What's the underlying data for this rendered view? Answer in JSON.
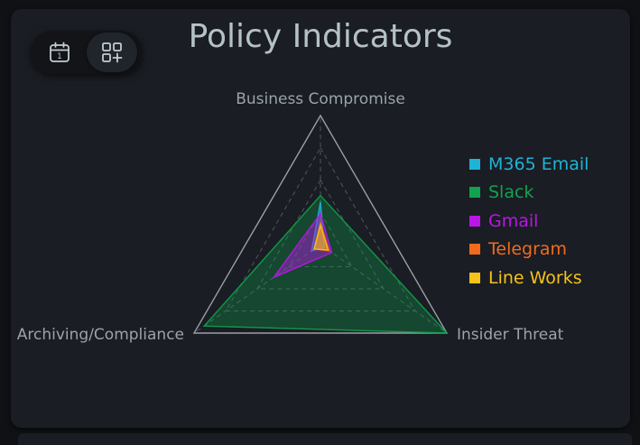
{
  "title": "Policy Indicators",
  "toolbar": {
    "calendar_icon": "calendar-icon",
    "calendar_day": "1",
    "grid_icon": "grid-add-icon"
  },
  "chart_data": {
    "type": "radar",
    "axes": [
      "Business Compromise",
      "Insider Threat",
      "Archiving/Compliance"
    ],
    "max": 1,
    "grid_levels": [
      0.25,
      0.5,
      0.75,
      1.0
    ],
    "legend_position": "right",
    "series": [
      {
        "name": "M365 Email",
        "color": "#1fb3d6",
        "values": [
          0.33,
          0.03,
          0.07
        ]
      },
      {
        "name": "Slack",
        "color": "#0fa34f",
        "values": [
          0.38,
          1.0,
          0.92
        ]
      },
      {
        "name": "Gmail",
        "color": "#b817e6",
        "values": [
          0.24,
          0.09,
          0.37
        ]
      },
      {
        "name": "Telegram",
        "color": "#f26b1d",
        "values": [
          0.17,
          0.07,
          0.05
        ]
      },
      {
        "name": "Line Works",
        "color": "#f5c31a",
        "values": [
          0.15,
          0.06,
          0.05
        ]
      }
    ]
  }
}
